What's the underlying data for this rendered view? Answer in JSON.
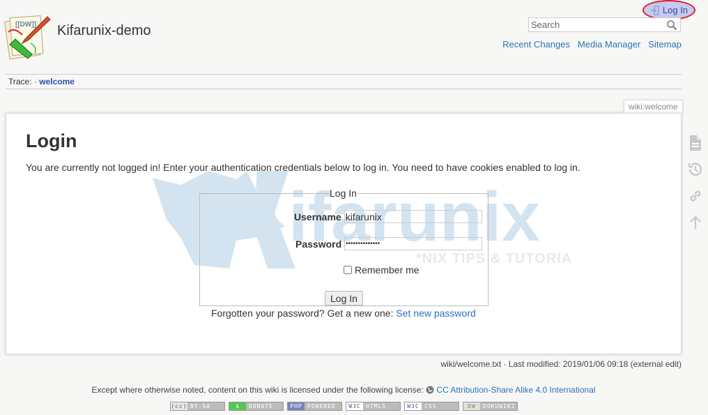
{
  "header": {
    "site_title": "Kifarunix-demo",
    "login_link": "Log In",
    "search_placeholder": "Search",
    "site_tools": [
      "Recent Changes",
      "Media Manager",
      "Sitemap"
    ]
  },
  "trace": {
    "label": "Trace:",
    "separator": "·",
    "crumb": "welcome"
  },
  "page": {
    "page_id": "wiki:welcome",
    "title": "Login",
    "intro": "You are currently not logged in! Enter your authentication credentials below to log in. You need to have cookies enabled to log in.",
    "form": {
      "legend": "Log In",
      "username_label": "Username",
      "username_value": "kifarunix",
      "password_label": "Password",
      "password_value": "••••••••••••••",
      "remember_label": "Remember me",
      "remember_checked": false,
      "submit_label": "Log In"
    },
    "forgot_text": "Forgotten your password? Get a new one:",
    "forgot_link": "Set new password"
  },
  "page_tools": [
    "show-page-icon",
    "old-revisions-icon",
    "backlinks-icon",
    "back-to-top-icon"
  ],
  "doc_info": "wiki/welcome.txt · Last modified: 2019/01/06 09:18 (external edit)",
  "footer": {
    "license_text": "Except where otherwise noted, content on this wiki is licensed under the following license:",
    "license_link": "CC Attribution-Share Alike 4.0 International",
    "badges": [
      {
        "left": "(cc)",
        "right": "BY-SA"
      },
      {
        "left": "$",
        "right": "DONATE"
      },
      {
        "left": "PHP",
        "right": "POWERED"
      },
      {
        "left": "W3C",
        "right": "HTML5"
      },
      {
        "left": "W3C",
        "right": "CSS"
      },
      {
        "left": "DW",
        "right": "DOKUWIKI"
      }
    ]
  },
  "colors": {
    "link": "#2b73b7",
    "highlight_ellipse": "#d61f2c",
    "highlight_fill": "#c8c8f0",
    "watermark": "#d3e4f0"
  }
}
